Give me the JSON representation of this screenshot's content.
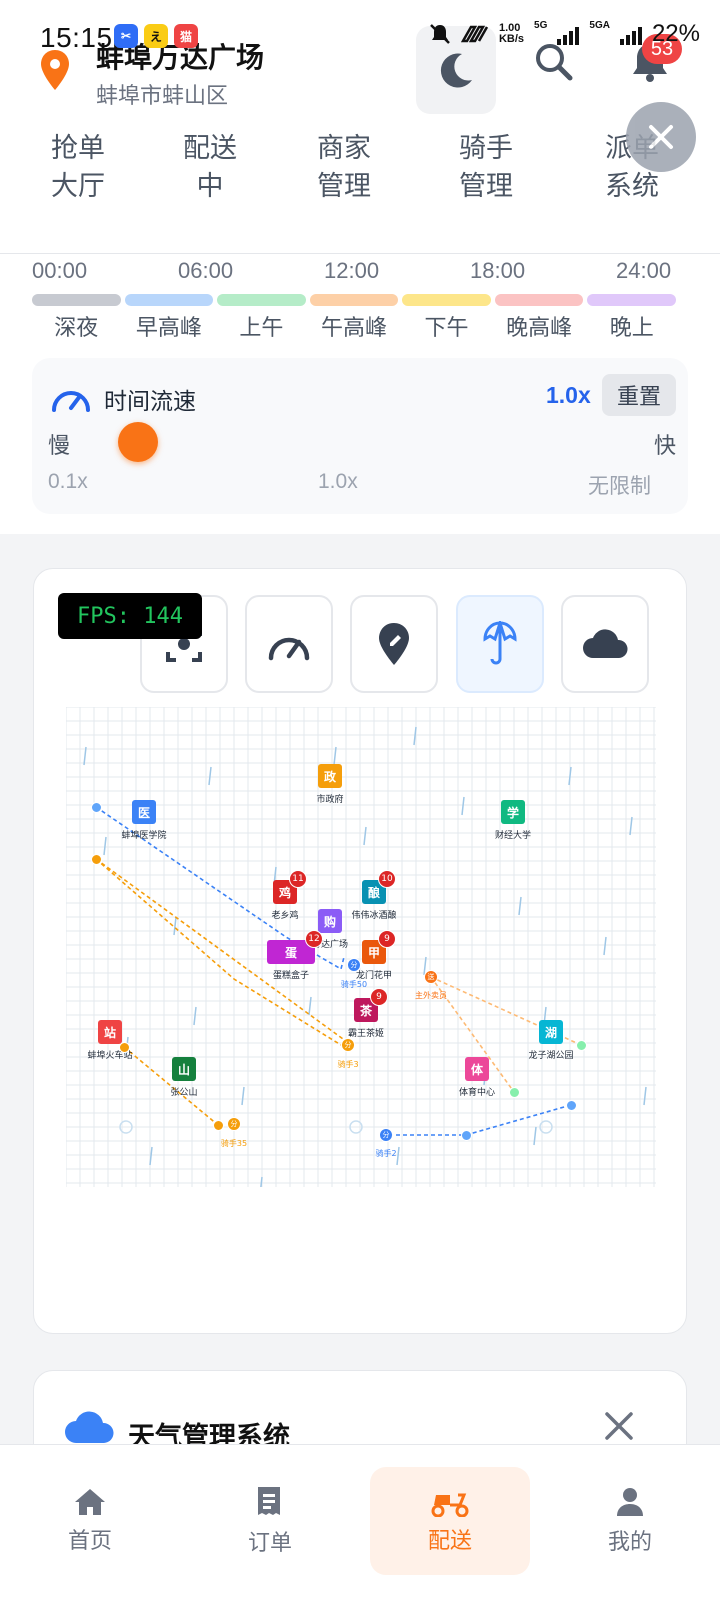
{
  "status_bar": {
    "time": "15:15",
    "net_speed": "1.00",
    "net_unit": "KB/s",
    "sig1": "5G",
    "sig2": "5GA",
    "battery": "22%"
  },
  "header": {
    "location_title": "蚌埠万达广场",
    "location_sub": "蚌埠市蚌山区",
    "notification_count": "53",
    "nav": [
      {
        "label": "抢单\n大厅"
      },
      {
        "label": "配送\n中"
      },
      {
        "label": "商家\n管理"
      },
      {
        "label": "骑手\n管理"
      },
      {
        "label": "派单\n系统"
      }
    ]
  },
  "timeline": {
    "times": [
      "00:00",
      "06:00",
      "12:00",
      "18:00",
      "24:00"
    ],
    "periods": [
      {
        "label": "深夜",
        "color": "#c7cad1"
      },
      {
        "label": "早高峰",
        "color": "#b8d6fb"
      },
      {
        "label": "上午",
        "color": "#b5ecc8"
      },
      {
        "label": "午高峰",
        "color": "#fdd0a7"
      },
      {
        "label": "下午",
        "color": "#fde68a"
      },
      {
        "label": "晚高峰",
        "color": "#fbc3c3"
      },
      {
        "label": "晚上",
        "color": "#e0c8fa"
      }
    ],
    "speed": {
      "title": "时间流速",
      "value": "1.0x",
      "reset": "重置",
      "slow": "慢",
      "fast": "快",
      "ticks": [
        "0.1x",
        "1.0x",
        "无限制"
      ],
      "slider_fraction": 0.05
    }
  },
  "map_card": {
    "fps": "FPS: 144",
    "tools": [
      {
        "icon": "screenshot-icon"
      },
      {
        "icon": "speedometer-icon"
      },
      {
        "icon": "map-pin-icon"
      },
      {
        "icon": "umbrella-icon",
        "active": true
      },
      {
        "icon": "cloud-icon"
      }
    ],
    "pois": [
      {
        "char": "政",
        "name": "市政府",
        "color": "#f59e0b"
      },
      {
        "char": "学",
        "name": "财经大学",
        "color": "#10b981"
      },
      {
        "char": "医",
        "name": "蚌埠医学院",
        "color": "#3b82f6"
      },
      {
        "char": "鸡",
        "name": "老乡鸡",
        "color": "#dc2626",
        "badge": "11"
      },
      {
        "char": "酿",
        "name": "伟伟冰酒酿",
        "color": "#0891b2",
        "badge": "10"
      },
      {
        "char": "购",
        "name": "万达广场",
        "color": "#8b5cf6"
      },
      {
        "char": "蛋",
        "name": "蛋糕盒子",
        "color": "#c026d3",
        "badge": "12"
      },
      {
        "char": "甲",
        "name": "龙门花甲",
        "color": "#ea580c",
        "badge": "9"
      },
      {
        "char": "茶",
        "name": "霸王茶姬",
        "color": "#be185d",
        "badge": "9"
      },
      {
        "char": "站",
        "name": "蚌埠火车站",
        "color": "#ef4444"
      },
      {
        "char": "山",
        "name": "张公山",
        "color": "#15803d"
      },
      {
        "char": "湖",
        "name": "龙子湖公园",
        "color": "#06b6d4"
      },
      {
        "char": "体",
        "name": "体育中心",
        "color": "#ec4899"
      }
    ],
    "riders": [
      {
        "name": "骑手50",
        "color": "#3b82f6",
        "mark": "分"
      },
      {
        "name": "骑手3",
        "color": "#f59e0b",
        "mark": "分"
      },
      {
        "name": "骑手35",
        "color": "#f59e0b",
        "mark": "分"
      },
      {
        "name": "骑手2",
        "color": "#3b82f6",
        "mark": "分"
      },
      {
        "name": "主外卖员",
        "color": "#f97316",
        "mark": "送"
      }
    ]
  },
  "weather_card": {
    "title": "天气管理系统"
  },
  "bottom_nav": [
    {
      "label": "首页",
      "icon": "home-icon"
    },
    {
      "label": "订单",
      "icon": "receipt-icon"
    },
    {
      "label": "配送",
      "icon": "scooter-icon",
      "active": true
    },
    {
      "label": "我的",
      "icon": "user-icon"
    }
  ]
}
